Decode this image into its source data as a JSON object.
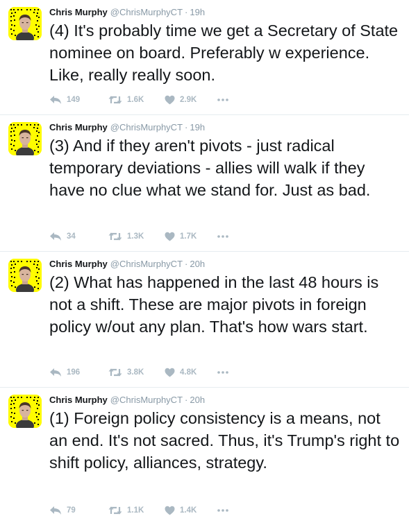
{
  "colors": {
    "snapcode_yellow": "#fffc00",
    "action_gray": "#aab8c2",
    "meta_gray": "#8899a6",
    "text": "#14171a",
    "divider": "#e6ecf0"
  },
  "icons": {
    "reply": "reply-icon",
    "retweet": "retweet-icon",
    "like": "heart-icon",
    "more": "more-icon"
  },
  "tweets": [
    {
      "name": "Chris Murphy",
      "handle": "@ChrisMurphyCT",
      "separator": "·",
      "time": "19h",
      "text": "(4) It's probably time we get a Secretary of State nominee on board. Preferably w experience. Like, really really soon.",
      "replies": "149",
      "retweets": "1.6K",
      "likes": "2.9K"
    },
    {
      "name": "Chris Murphy",
      "handle": "@ChrisMurphyCT",
      "separator": "·",
      "time": "19h",
      "text": "(3) And if they aren't pivots - just radical temporary deviations - allies will walk if they have no clue what we stand for. Just as bad.",
      "replies": "34",
      "retweets": "1.3K",
      "likes": "1.7K"
    },
    {
      "name": "Chris Murphy",
      "handle": "@ChrisMurphyCT",
      "separator": "·",
      "time": "20h",
      "text": "(2) What has happened in the last 48 hours is not a shift. These are major pivots in foreign policy w/out any plan. That's how wars start.",
      "replies": "196",
      "retweets": "3.8K",
      "likes": "4.8K"
    },
    {
      "name": "Chris Murphy",
      "handle": "@ChrisMurphyCT",
      "separator": "·",
      "time": "20h",
      "text": "(1) Foreign policy consistency is a means, not an end. It's not sacred. Thus, it's Trump's right to shift policy, alliances, strategy.",
      "replies": "79",
      "retweets": "1.1K",
      "likes": "1.4K"
    }
  ]
}
